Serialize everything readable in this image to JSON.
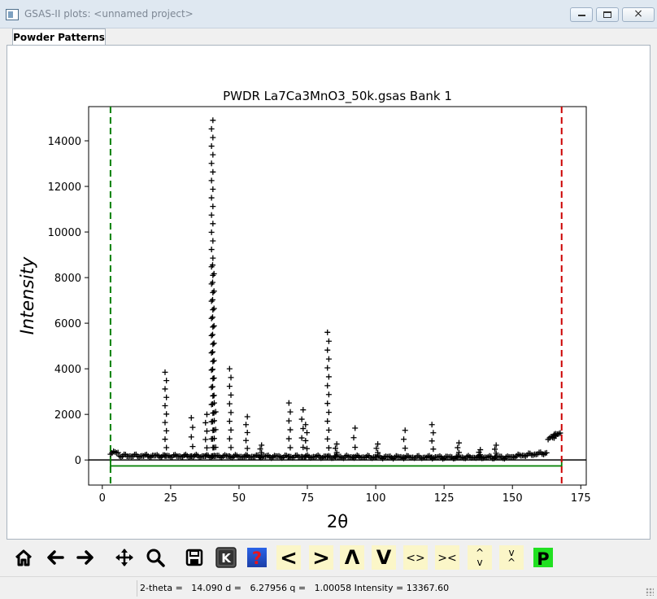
{
  "window": {
    "title": "GSAS-II plots: <unnamed project>",
    "min_glyph": "",
    "max_glyph": "",
    "close_glyph": "×"
  },
  "tabs": [
    {
      "label": "Powder Patterns",
      "active": true
    }
  ],
  "chart_data": {
    "type": "scatter",
    "title": "PWDR La7Ca3MnO3_50k.gsas Bank 1",
    "xlabel": "2θ",
    "ylabel": "Intensity",
    "xlim": [
      -5,
      177
    ],
    "ylim": [
      -1100,
      15500
    ],
    "xticks": [
      0,
      25,
      50,
      75,
      100,
      125,
      150,
      175
    ],
    "yticks": [
      0,
      2000,
      4000,
      6000,
      8000,
      10000,
      12000,
      14000
    ],
    "grid": false,
    "legend": "none",
    "marker": "+",
    "colors": {
      "observed": "#000000",
      "lower_limit": "#008000",
      "upper_limit": "#cc0000",
      "background_line": "#008000",
      "zero_line": "#000000"
    },
    "limits": {
      "lower": 3.0,
      "upper": 168.0
    },
    "difference_offset": -260,
    "peaks": [
      {
        "x": 23.2,
        "y": 3850
      },
      {
        "x": 32.8,
        "y": 1850
      },
      {
        "x": 38.0,
        "y": 2000
      },
      {
        "x": 40.2,
        "y": 14900
      },
      {
        "x": 40.6,
        "y": 8550
      },
      {
        "x": 41.2,
        "y": 2500
      },
      {
        "x": 46.8,
        "y": 4000
      },
      {
        "x": 52.8,
        "y": 1900
      },
      {
        "x": 58.0,
        "y": 650
      },
      {
        "x": 68.5,
        "y": 2500
      },
      {
        "x": 73.2,
        "y": 2200
      },
      {
        "x": 74.6,
        "y": 1550
      },
      {
        "x": 82.6,
        "y": 5600
      },
      {
        "x": 85.5,
        "y": 700
      },
      {
        "x": 92.2,
        "y": 1400
      },
      {
        "x": 100.5,
        "y": 700
      },
      {
        "x": 110.5,
        "y": 1300
      },
      {
        "x": 120.8,
        "y": 1550
      },
      {
        "x": 130.2,
        "y": 750
      },
      {
        "x": 138.0,
        "y": 450
      },
      {
        "x": 143.8,
        "y": 650
      },
      {
        "x": 165.5,
        "y": 1150
      }
    ]
  },
  "toolbar": [
    {
      "name": "home-button",
      "icon": "home-icon"
    },
    {
      "name": "back-button",
      "icon": "arrow-left-icon"
    },
    {
      "name": "forward-button",
      "icon": "arrow-right-icon"
    },
    {
      "name": "pan-button",
      "icon": "move-icon"
    },
    {
      "name": "zoom-button",
      "icon": "magnifier-icon"
    },
    {
      "name": "save-button",
      "icon": "floppy-icon"
    },
    {
      "name": "key-button",
      "icon": "k-key-icon",
      "label": "K"
    },
    {
      "name": "help-button",
      "icon": "help-icon",
      "label": "?"
    },
    {
      "name": "shift-left-button",
      "label": "<"
    },
    {
      "name": "shift-right-button",
      "label": ">"
    },
    {
      "name": "shift-up-button",
      "label": "Λ"
    },
    {
      "name": "shift-down-button",
      "label": "V"
    },
    {
      "name": "expand-x-button",
      "label": "<>"
    },
    {
      "name": "contract-x-button",
      "label": "><"
    },
    {
      "name": "expand-y-button",
      "label": "^\nv"
    },
    {
      "name": "contract-y-button",
      "label": "v\n^"
    },
    {
      "name": "publish-button",
      "icon": "p-icon",
      "label": "P"
    }
  ],
  "status": {
    "left": "",
    "text": "2-theta =   14.090 d =   6.27956 q =   1.00058 Intensity = 13367.60"
  }
}
